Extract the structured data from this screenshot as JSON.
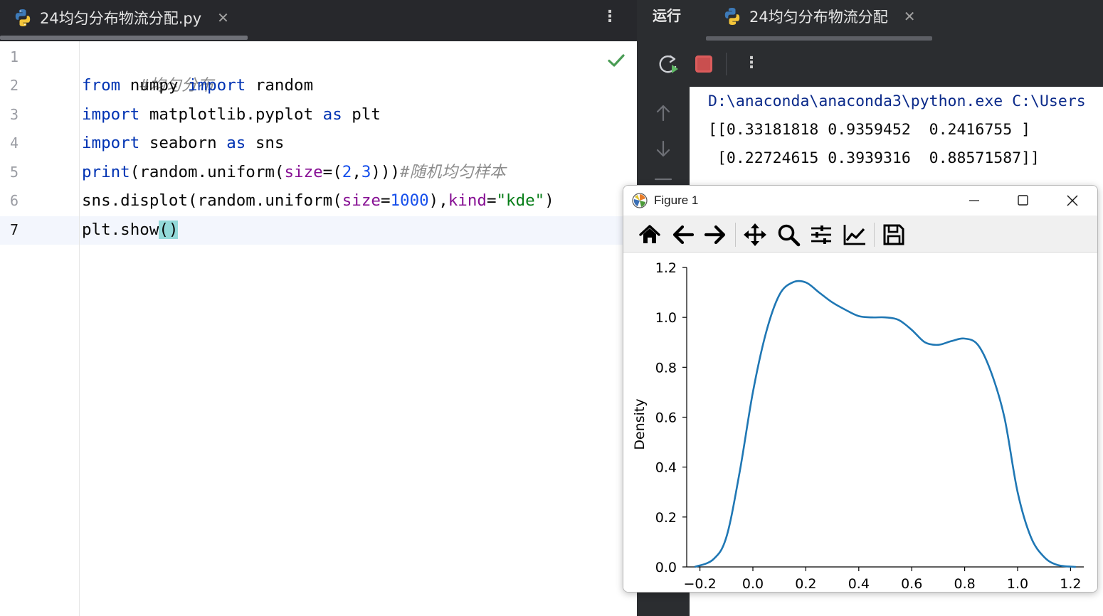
{
  "editor": {
    "tab": {
      "title": "24均匀分布物流分配.py",
      "close": "✕"
    },
    "more_label": "⋮",
    "line_numbers": [
      "1",
      "2",
      "3",
      "4",
      "5",
      "6",
      "7"
    ],
    "code": {
      "l1": {
        "comment": "#均匀分布"
      },
      "l2": {
        "t1": "from",
        "t2": " numpy ",
        "t3": "import",
        "t4": " random"
      },
      "l3": {
        "t1": "import",
        "t2": " matplotlib.pyplot ",
        "t3": "as",
        "t4": " plt"
      },
      "l4": {
        "t1": "import",
        "t2": " seaborn ",
        "t3": "as",
        "t4": " sns"
      },
      "l5": {
        "t1": "print",
        "t2": "(random.uniform(",
        "t3": "size",
        "t4": "=(",
        "t5": "2",
        "t6": ",",
        "t7": "3",
        "t8": ")))",
        "t9": "#随机均匀样本"
      },
      "l6": {
        "t1": "sns.displot(random.uniform(",
        "t2": "size",
        "t3": "=",
        "t4": "1000",
        "t5": "),",
        "t6": "kind",
        "t7": "=",
        "t8": "\"kde\"",
        "t9": ")"
      },
      "l7": {
        "t1": "plt.show",
        "t2": "()"
      }
    },
    "status_icon": "check-icon"
  },
  "run_panel": {
    "title": "运行",
    "tab": {
      "title": "24均匀分布物流分配",
      "close": "✕"
    },
    "more_label": "⋮",
    "console": {
      "command": "D:\\anaconda\\anaconda3\\python.exe C:\\Users",
      "output": [
        "[[0.33181818 0.9359452  0.2416755 ]",
        " [0.22724615 0.3939316  0.88571587]]"
      ]
    }
  },
  "figure_window": {
    "title": "Figure 1",
    "toolbar_icons": [
      "home-icon",
      "back-icon",
      "forward-icon",
      "pan-icon",
      "zoom-icon",
      "configure-subplots-icon",
      "edit-axis-icon",
      "save-icon"
    ]
  },
  "chart_data": {
    "type": "line",
    "title": "",
    "xlabel": "",
    "ylabel": "Density",
    "xlim": [
      -0.25,
      1.25
    ],
    "ylim": [
      0.0,
      1.2
    ],
    "x_ticks": [
      "−0.2",
      "0.0",
      "0.2",
      "0.4",
      "0.6",
      "0.8",
      "1.0",
      "1.2"
    ],
    "x_tick_values": [
      -0.2,
      0.0,
      0.2,
      0.4,
      0.6,
      0.8,
      1.0,
      1.2
    ],
    "y_ticks": [
      "0.0",
      "0.2",
      "0.4",
      "0.6",
      "0.8",
      "1.0",
      "1.2"
    ],
    "y_tick_values": [
      0.0,
      0.2,
      0.4,
      0.6,
      0.8,
      1.0,
      1.2
    ],
    "grid": false,
    "color": "#1f77b4",
    "series": [
      {
        "x": [
          -0.22,
          -0.15,
          -0.1,
          -0.05,
          0.0,
          0.05,
          0.1,
          0.15,
          0.2,
          0.25,
          0.3,
          0.35,
          0.4,
          0.45,
          0.5,
          0.55,
          0.6,
          0.65,
          0.7,
          0.75,
          0.8,
          0.85,
          0.9,
          0.95,
          1.0,
          1.05,
          1.1,
          1.15,
          1.22
        ],
        "y": [
          0.0,
          0.03,
          0.12,
          0.38,
          0.7,
          0.94,
          1.09,
          1.14,
          1.14,
          1.1,
          1.06,
          1.03,
          1.005,
          1.0,
          1.0,
          0.99,
          0.95,
          0.9,
          0.89,
          0.905,
          0.915,
          0.89,
          0.78,
          0.6,
          0.3,
          0.12,
          0.04,
          0.008,
          0.0
        ]
      }
    ]
  }
}
